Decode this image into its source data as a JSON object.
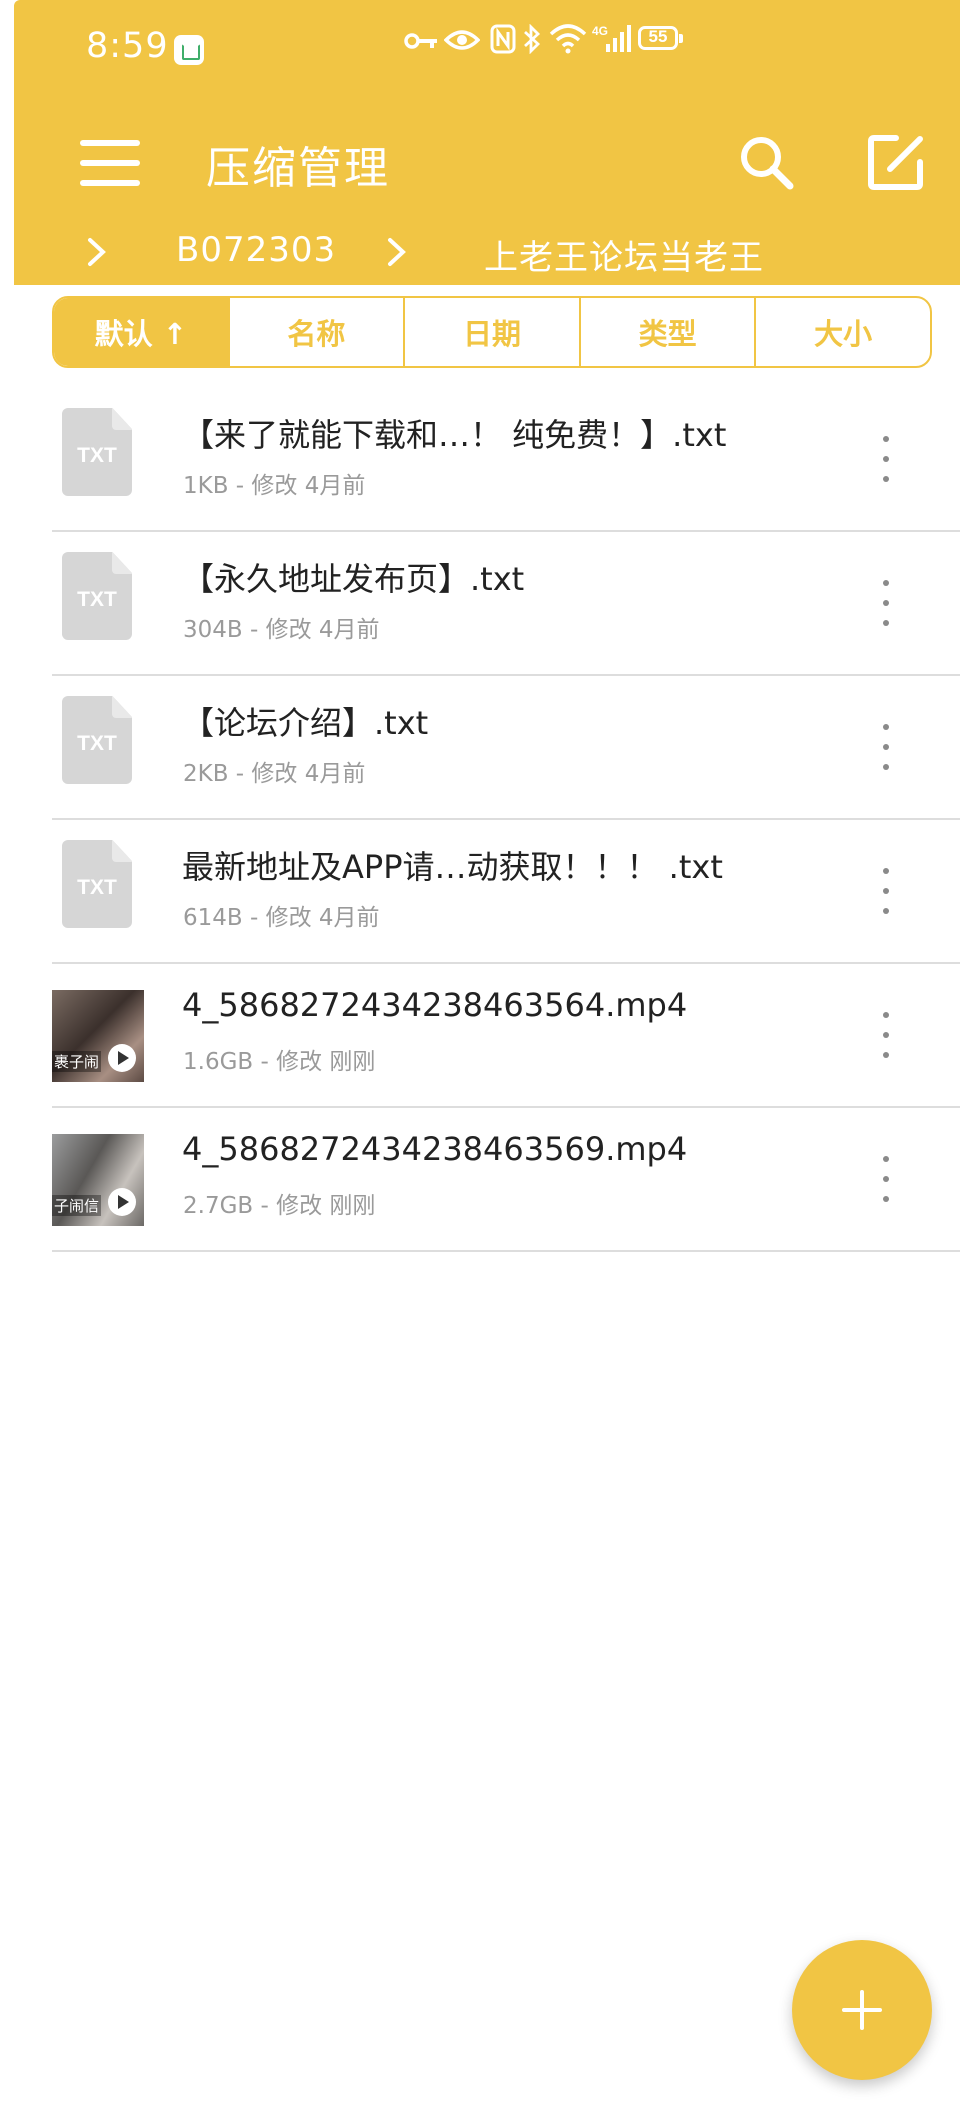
{
  "status_bar": {
    "time": "8:59",
    "battery": "55",
    "icons": [
      "app-store-icon",
      "key-icon",
      "eye-icon",
      "nfc-icon",
      "bluetooth-icon",
      "wifi-icon",
      "signal-icon",
      "battery-icon"
    ]
  },
  "toolbar": {
    "title": "压缩管理"
  },
  "breadcrumb": {
    "items": [
      "B072303",
      "上老王论坛当老王"
    ]
  },
  "sort_tabs": [
    {
      "label": "默认 ↑",
      "active": true
    },
    {
      "label": "名称",
      "active": false
    },
    {
      "label": "日期",
      "active": false
    },
    {
      "label": "类型",
      "active": false
    },
    {
      "label": "大小",
      "active": false
    }
  ],
  "files": [
    {
      "name": "【来了就能下载和…！ 纯免费！】.txt",
      "meta": "1KB - 修改 4月前",
      "type": "txt",
      "icon_label": "TXT"
    },
    {
      "name": "【永久地址发布页】.txt",
      "meta": "304B - 修改 4月前",
      "type": "txt",
      "icon_label": "TXT"
    },
    {
      "name": "【论坛介绍】.txt",
      "meta": "2KB - 修改 4月前",
      "type": "txt",
      "icon_label": "TXT"
    },
    {
      "name": "最新地址及APP请…动获取！！！ .txt",
      "meta": "614B - 修改 4月前",
      "type": "txt",
      "icon_label": "TXT"
    },
    {
      "name": "4_5868272434238463564.mp4",
      "meta": "1.6GB - 修改 刚刚",
      "type": "video",
      "thumb_caption": "裹子闹"
    },
    {
      "name": "4_5868272434238463569.mp4",
      "meta": "2.7GB - 修改 刚刚",
      "type": "video",
      "thumb_caption": "子闹信"
    }
  ],
  "colors": {
    "accent": "#f1c544",
    "divider": "#dddddd",
    "meta_text": "#9a9a9a",
    "file_icon": "#d6d6d6"
  }
}
